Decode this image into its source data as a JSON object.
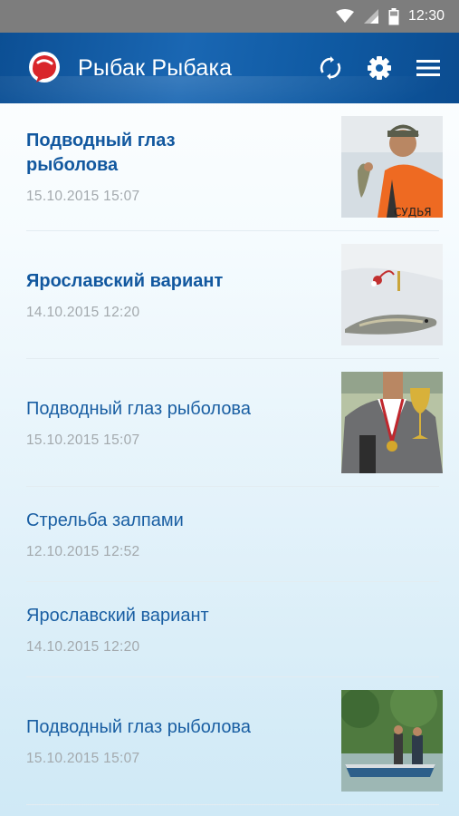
{
  "status_bar": {
    "time": "12:30",
    "icons": [
      "wifi-icon",
      "signal-icon",
      "battery-icon"
    ]
  },
  "app_bar": {
    "title": "Рыбак Рыбака",
    "logo": "app-logo-icon",
    "actions": [
      "refresh-icon",
      "settings-icon",
      "menu-icon"
    ],
    "color": "#0f5aa3"
  },
  "articles": [
    {
      "title": "Подводный глаз рыболова",
      "date": "15.10.2015  15:07",
      "bold": true,
      "thumb": "angler-with-fish-photo"
    },
    {
      "title": "Ярославский вариант",
      "date": "14.10.2015  12:20",
      "bold": true,
      "thumb": "pike-on-ice-photo"
    },
    {
      "title": "Подводный глаз рыболова",
      "date": "15.10.2015  15:07",
      "bold": false,
      "thumb": "winner-with-trophy-photo"
    },
    {
      "title": "Стрельба залпами",
      "date": "12.10.2015  12:52",
      "bold": false,
      "thumb": null
    },
    {
      "title": "Ярославский вариант",
      "date": "14.10.2015  12:20",
      "bold": false,
      "thumb": null
    },
    {
      "title": "Подводный глаз рыболова",
      "date": "15.10.2015  15:07",
      "bold": false,
      "thumb": "anglers-in-boat-photo"
    }
  ]
}
